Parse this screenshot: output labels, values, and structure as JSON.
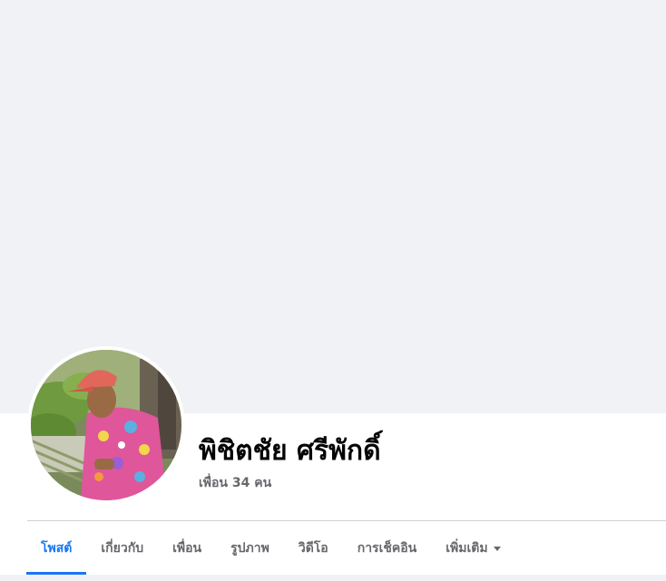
{
  "profile": {
    "name": "พิชิตชัย ศรีพักดิ์",
    "friends_text": "เพื่อน 34 คน"
  },
  "tabs": [
    {
      "label": "โพสต์",
      "active": true
    },
    {
      "label": "เกี่ยวกับ",
      "active": false
    },
    {
      "label": "เพื่อน",
      "active": false
    },
    {
      "label": "รูปภาพ",
      "active": false
    },
    {
      "label": "วิดีโอ",
      "active": false
    },
    {
      "label": "การเช็คอิน",
      "active": false
    },
    {
      "label": "เพิ่มเติม",
      "active": false,
      "icon": "caret-down-icon"
    }
  ],
  "colors": {
    "accent": "#1877f2",
    "cover_background": "#f0f2f5",
    "secondary_text": "#65676b",
    "primary_text": "#050505"
  }
}
